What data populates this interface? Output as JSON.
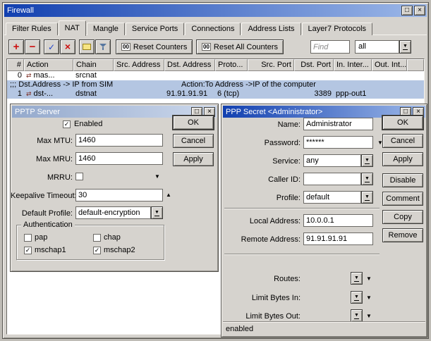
{
  "colors": {
    "titlebar_active": "#1240b0",
    "titlebar_inactive": "#94a9cc",
    "selection": "#b4c6e2",
    "window_bg": "#d6d3ce"
  },
  "icons": {
    "maximize": "□",
    "close": "×",
    "dropdown": "▼",
    "expand_down": "▼",
    "collapse_up": "▲",
    "checkmark": "✓",
    "add": "+",
    "remove": "−",
    "enable_check": "✓",
    "disable_cross": "×",
    "nat_action": "⇄"
  },
  "firewall": {
    "title": "Firewall",
    "tabs": [
      "Filter Rules",
      "NAT",
      "Mangle",
      "Service Ports",
      "Connections",
      "Address Lists",
      "Layer7 Protocols"
    ],
    "active_tab": "NAT",
    "toolbar": {
      "counters_icon": "00",
      "reset_counters_label": "Reset Counters",
      "reset_all_counters_label": "Reset All Counters",
      "find_placeholder": "Find",
      "filter_value": "all"
    },
    "columns": [
      "#",
      "Action",
      "Chain",
      "Src. Address",
      "Dst. Address",
      "Proto...",
      "Src. Port",
      "Dst. Port",
      "In. Inter...",
      "Out. Int..."
    ],
    "rows": {
      "r0": {
        "num": "0",
        "action": "mas...",
        "chain": "srcnat"
      },
      "comment": {
        "left": ";;; Dst.Address -> IP from SIM",
        "right": "Action:To Address ->IP of the computer"
      },
      "r1": {
        "num": "1",
        "action": "dst-...",
        "chain": "dstnat",
        "dst_address": "91.91.91.91",
        "protocol": "6 (tcp)",
        "dst_port": "3389",
        "in_interface": "ppp-out1"
      }
    }
  },
  "pptp_server": {
    "title": "PPTP Server",
    "enabled_label": "Enabled",
    "enabled_checked": true,
    "fields": {
      "max_mtu": {
        "label": "Max MTU:",
        "value": "1460"
      },
      "max_mru": {
        "label": "Max MRU:",
        "value": "1460"
      },
      "mrru": {
        "label": "MRRU:",
        "checked": false
      },
      "keepalive": {
        "label": "Keepalive Timeout:",
        "value": "30"
      },
      "default_profile": {
        "label": "Default Profile:",
        "value": "default-encryption"
      }
    },
    "auth": {
      "group_label": "Authentication",
      "pap": {
        "label": "pap",
        "checked": false
      },
      "chap": {
        "label": "chap",
        "checked": false
      },
      "mschap1": {
        "label": "mschap1",
        "checked": true
      },
      "mschap2": {
        "label": "mschap2",
        "checked": true
      }
    },
    "buttons": {
      "ok": "OK",
      "cancel": "Cancel",
      "apply": "Apply"
    }
  },
  "ppp_secret": {
    "title": "PPP Secret <Administrator>",
    "fields": {
      "name": {
        "label": "Name:",
        "value": "Administrator"
      },
      "password": {
        "label": "Password:",
        "value": "******"
      },
      "service": {
        "label": "Service:",
        "value": "any"
      },
      "caller_id": {
        "label": "Caller ID:",
        "value": ""
      },
      "profile": {
        "label": "Profile:",
        "value": "default"
      },
      "local_address": {
        "label": "Local Address:",
        "value": "10.0.0.1"
      },
      "remote_address": {
        "label": "Remote Address:",
        "value": "91.91.91.91"
      },
      "routes": {
        "label": "Routes:",
        "value": ""
      },
      "limit_bytes_in": {
        "label": "Limit Bytes In:",
        "value": ""
      },
      "limit_bytes_out": {
        "label": "Limit Bytes Out:",
        "value": ""
      }
    },
    "buttons": {
      "ok": "OK",
      "cancel": "Cancel",
      "apply": "Apply",
      "disable": "Disable",
      "comment": "Comment",
      "copy": "Copy",
      "remove": "Remove"
    },
    "status": "enabled"
  }
}
